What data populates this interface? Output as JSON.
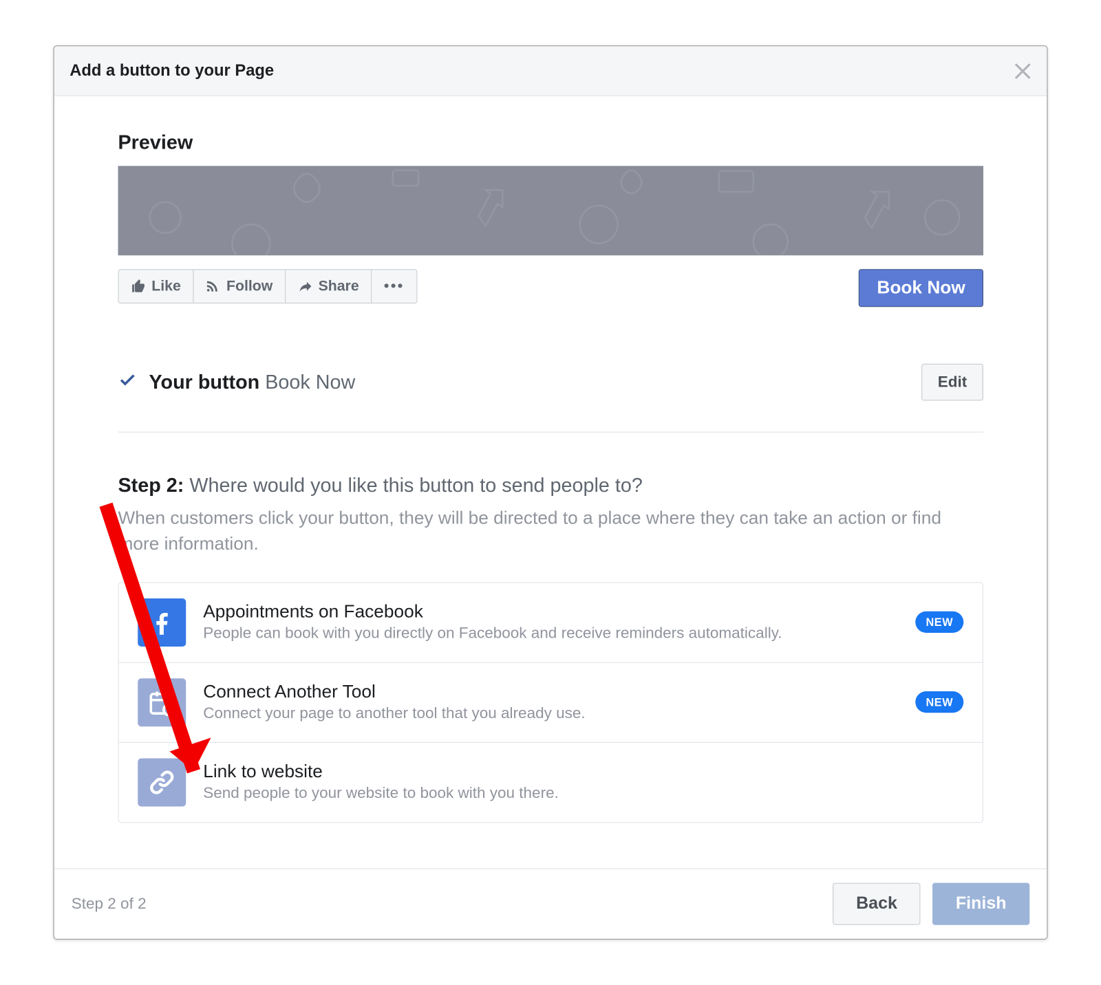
{
  "dialog": {
    "title": "Add a button to your Page"
  },
  "preview": {
    "heading": "Preview",
    "actions": {
      "like": "Like",
      "follow": "Follow",
      "share": "Share"
    },
    "cta": "Book Now"
  },
  "your_button": {
    "label": "Your button",
    "value": "Book Now",
    "edit": "Edit"
  },
  "step2": {
    "label": "Step 2:",
    "question": "Where would you like this button to send people to?",
    "description": "When customers click your button, they will be directed to a place where they can take an action or find more information."
  },
  "options": [
    {
      "title": "Appointments on Facebook",
      "desc": "People can book with you directly on Facebook and receive reminders automatically.",
      "badge": "NEW",
      "icon": "facebook"
    },
    {
      "title": "Connect Another Tool",
      "desc": "Connect your page to another tool that you already use.",
      "badge": "NEW",
      "icon": "calendar-plus"
    },
    {
      "title": "Link to website",
      "desc": "Send people to your website to book with you there.",
      "badge": "",
      "icon": "link"
    }
  ],
  "footer": {
    "step_indicator": "Step 2 of 2",
    "back": "Back",
    "finish": "Finish"
  }
}
